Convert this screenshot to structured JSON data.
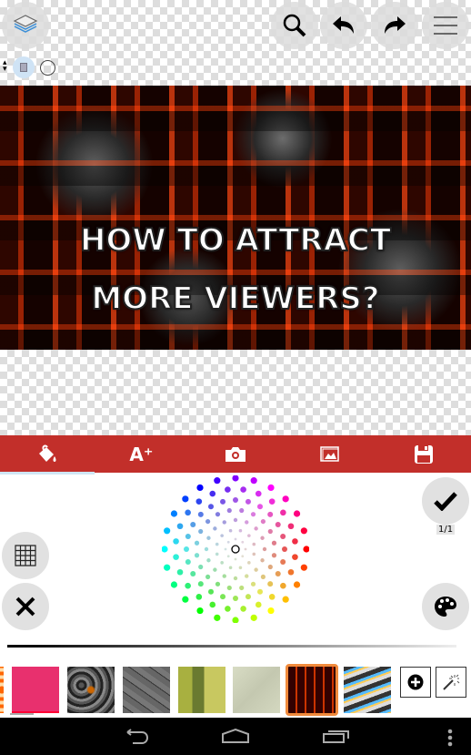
{
  "toolbar": {
    "layers_icon": "layers-icon",
    "zoom_icon": "search-icon",
    "undo_icon": "undo-icon",
    "redo_icon": "redo-icon",
    "menu_icon": "menu-icon"
  },
  "canvas": {
    "line1": "HOW TO ATTRACT",
    "line2": "MORE VIEWERS?"
  },
  "tabs": [
    {
      "icon": "paint-bucket-icon"
    },
    {
      "label": "A⁺",
      "icon": "add-text-icon"
    },
    {
      "icon": "camera-icon"
    },
    {
      "icon": "image-icon"
    },
    {
      "icon": "save-icon"
    }
  ],
  "panel": {
    "page_counter": "1/1"
  },
  "swatches": [
    "#e8306e",
    "texture-lava-rock",
    "texture-cracked-earth",
    "texture-farmland",
    "texture-pale-stone",
    "texture-red-grid",
    "texture-swirl"
  ],
  "selected_swatch": 5,
  "colors": {
    "accent": "#c22f2a",
    "selection": "#f08a3c"
  }
}
